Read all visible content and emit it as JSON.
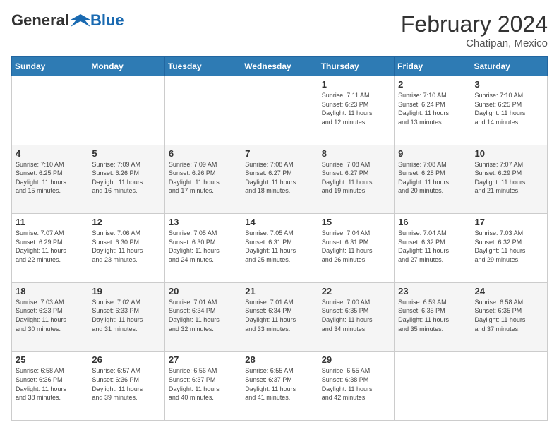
{
  "header": {
    "logo_general": "General",
    "logo_blue": "Blue",
    "main_title": "February 2024",
    "subtitle": "Chatipan, Mexico"
  },
  "days_of_week": [
    "Sunday",
    "Monday",
    "Tuesday",
    "Wednesday",
    "Thursday",
    "Friday",
    "Saturday"
  ],
  "weeks": [
    {
      "days": [
        {
          "number": "",
          "info": ""
        },
        {
          "number": "",
          "info": ""
        },
        {
          "number": "",
          "info": ""
        },
        {
          "number": "",
          "info": ""
        },
        {
          "number": "1",
          "info": "Sunrise: 7:11 AM\nSunset: 6:23 PM\nDaylight: 11 hours\nand 12 minutes."
        },
        {
          "number": "2",
          "info": "Sunrise: 7:10 AM\nSunset: 6:24 PM\nDaylight: 11 hours\nand 13 minutes."
        },
        {
          "number": "3",
          "info": "Sunrise: 7:10 AM\nSunset: 6:25 PM\nDaylight: 11 hours\nand 14 minutes."
        }
      ]
    },
    {
      "days": [
        {
          "number": "4",
          "info": "Sunrise: 7:10 AM\nSunset: 6:25 PM\nDaylight: 11 hours\nand 15 minutes."
        },
        {
          "number": "5",
          "info": "Sunrise: 7:09 AM\nSunset: 6:26 PM\nDaylight: 11 hours\nand 16 minutes."
        },
        {
          "number": "6",
          "info": "Sunrise: 7:09 AM\nSunset: 6:26 PM\nDaylight: 11 hours\nand 17 minutes."
        },
        {
          "number": "7",
          "info": "Sunrise: 7:08 AM\nSunset: 6:27 PM\nDaylight: 11 hours\nand 18 minutes."
        },
        {
          "number": "8",
          "info": "Sunrise: 7:08 AM\nSunset: 6:27 PM\nDaylight: 11 hours\nand 19 minutes."
        },
        {
          "number": "9",
          "info": "Sunrise: 7:08 AM\nSunset: 6:28 PM\nDaylight: 11 hours\nand 20 minutes."
        },
        {
          "number": "10",
          "info": "Sunrise: 7:07 AM\nSunset: 6:29 PM\nDaylight: 11 hours\nand 21 minutes."
        }
      ]
    },
    {
      "days": [
        {
          "number": "11",
          "info": "Sunrise: 7:07 AM\nSunset: 6:29 PM\nDaylight: 11 hours\nand 22 minutes."
        },
        {
          "number": "12",
          "info": "Sunrise: 7:06 AM\nSunset: 6:30 PM\nDaylight: 11 hours\nand 23 minutes."
        },
        {
          "number": "13",
          "info": "Sunrise: 7:05 AM\nSunset: 6:30 PM\nDaylight: 11 hours\nand 24 minutes."
        },
        {
          "number": "14",
          "info": "Sunrise: 7:05 AM\nSunset: 6:31 PM\nDaylight: 11 hours\nand 25 minutes."
        },
        {
          "number": "15",
          "info": "Sunrise: 7:04 AM\nSunset: 6:31 PM\nDaylight: 11 hours\nand 26 minutes."
        },
        {
          "number": "16",
          "info": "Sunrise: 7:04 AM\nSunset: 6:32 PM\nDaylight: 11 hours\nand 27 minutes."
        },
        {
          "number": "17",
          "info": "Sunrise: 7:03 AM\nSunset: 6:32 PM\nDaylight: 11 hours\nand 29 minutes."
        }
      ]
    },
    {
      "days": [
        {
          "number": "18",
          "info": "Sunrise: 7:03 AM\nSunset: 6:33 PM\nDaylight: 11 hours\nand 30 minutes."
        },
        {
          "number": "19",
          "info": "Sunrise: 7:02 AM\nSunset: 6:33 PM\nDaylight: 11 hours\nand 31 minutes."
        },
        {
          "number": "20",
          "info": "Sunrise: 7:01 AM\nSunset: 6:34 PM\nDaylight: 11 hours\nand 32 minutes."
        },
        {
          "number": "21",
          "info": "Sunrise: 7:01 AM\nSunset: 6:34 PM\nDaylight: 11 hours\nand 33 minutes."
        },
        {
          "number": "22",
          "info": "Sunrise: 7:00 AM\nSunset: 6:35 PM\nDaylight: 11 hours\nand 34 minutes."
        },
        {
          "number": "23",
          "info": "Sunrise: 6:59 AM\nSunset: 6:35 PM\nDaylight: 11 hours\nand 35 minutes."
        },
        {
          "number": "24",
          "info": "Sunrise: 6:58 AM\nSunset: 6:35 PM\nDaylight: 11 hours\nand 37 minutes."
        }
      ]
    },
    {
      "days": [
        {
          "number": "25",
          "info": "Sunrise: 6:58 AM\nSunset: 6:36 PM\nDaylight: 11 hours\nand 38 minutes."
        },
        {
          "number": "26",
          "info": "Sunrise: 6:57 AM\nSunset: 6:36 PM\nDaylight: 11 hours\nand 39 minutes."
        },
        {
          "number": "27",
          "info": "Sunrise: 6:56 AM\nSunset: 6:37 PM\nDaylight: 11 hours\nand 40 minutes."
        },
        {
          "number": "28",
          "info": "Sunrise: 6:55 AM\nSunset: 6:37 PM\nDaylight: 11 hours\nand 41 minutes."
        },
        {
          "number": "29",
          "info": "Sunrise: 6:55 AM\nSunset: 6:38 PM\nDaylight: 11 hours\nand 42 minutes."
        },
        {
          "number": "",
          "info": ""
        },
        {
          "number": "",
          "info": ""
        }
      ]
    }
  ]
}
